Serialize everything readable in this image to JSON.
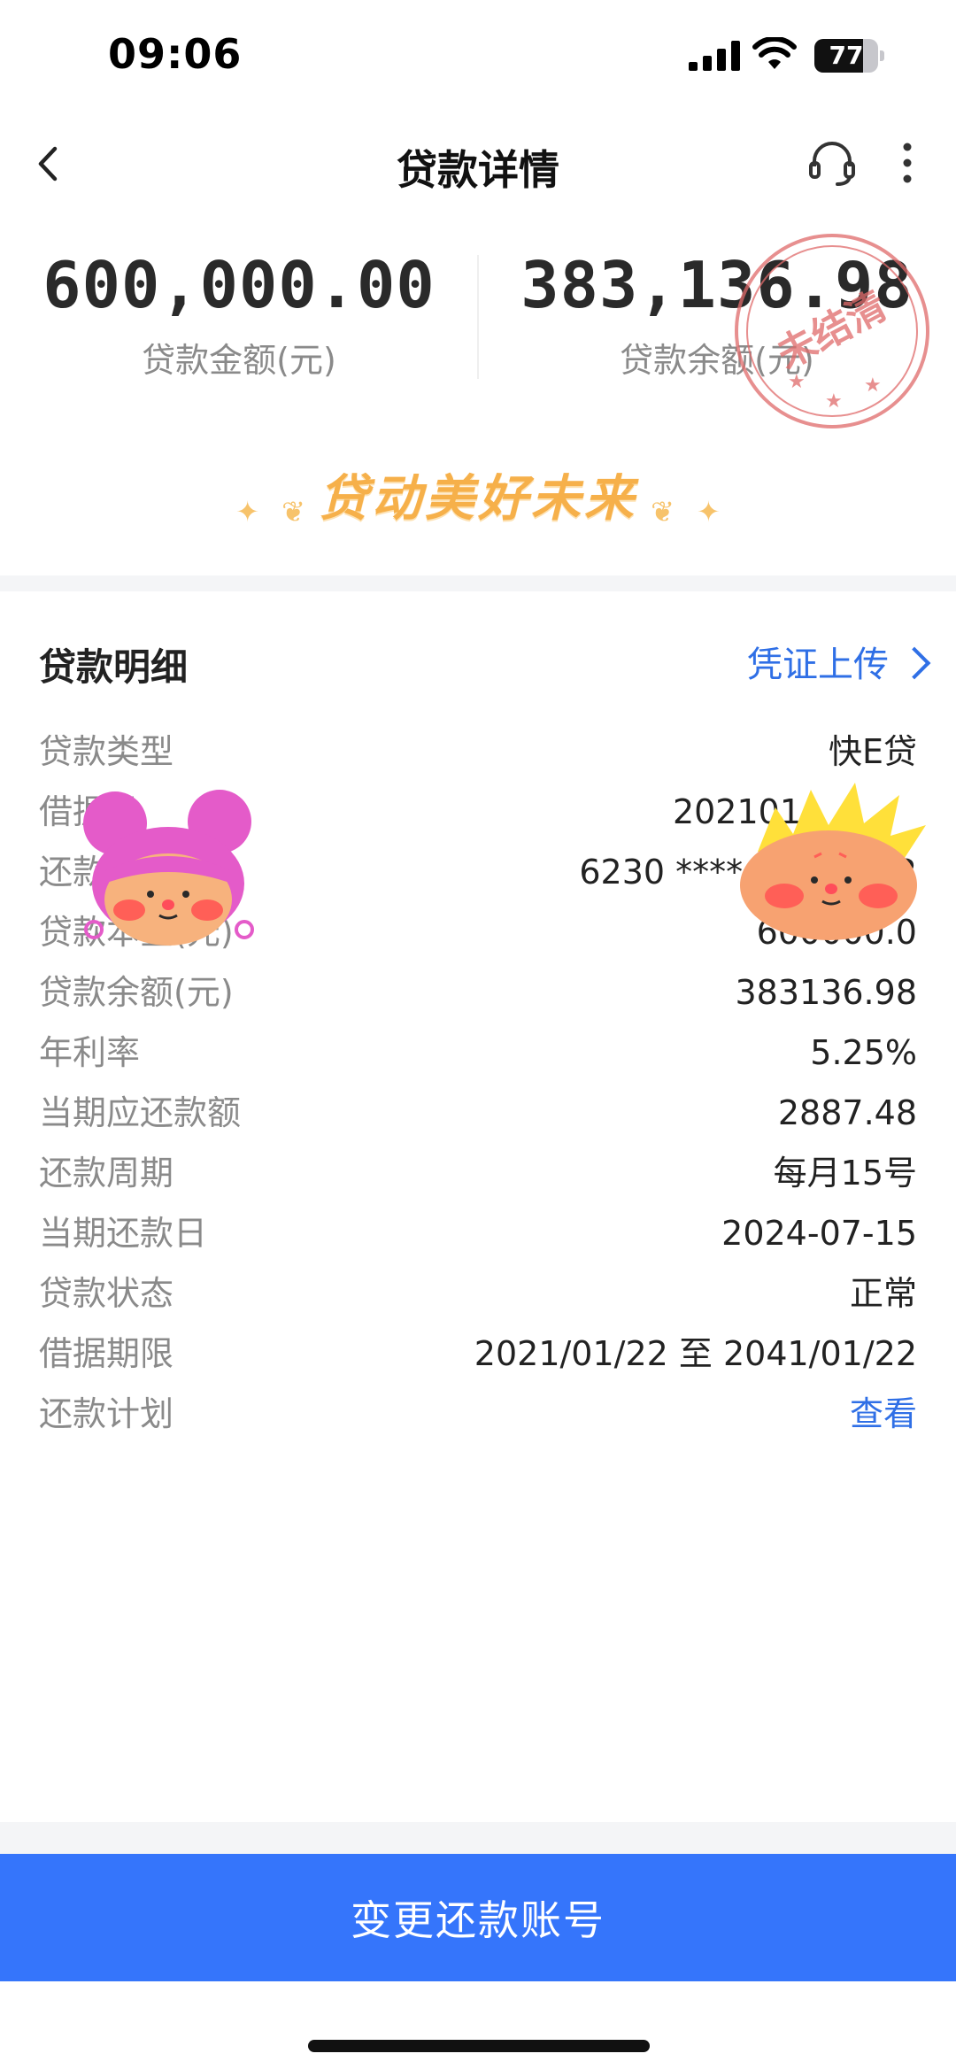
{
  "status_bar": {
    "time": "09:06",
    "battery_level": "77"
  },
  "nav": {
    "title": "贷款详情",
    "icons": [
      "back-arrow-icon",
      "headset-icon",
      "more-icon"
    ]
  },
  "summary": {
    "loan_amount": "600,000.00",
    "loan_amount_label": "贷款金额(元)",
    "balance": "383,136.98",
    "balance_label": "贷款余额(元)",
    "stamp_text": "未结清",
    "slogan": "贷动美好未来"
  },
  "details": {
    "title": "贷款明细",
    "upload_link": "凭证上传",
    "rows": [
      {
        "label": "贷款类型",
        "value": "快E贷"
      },
      {
        "label": "借据号",
        "value": "202101"
      },
      {
        "label": "还款账号",
        "value": "6230 **** **** 5512"
      },
      {
        "label": "贷款本金(元)",
        "value": "600000.0"
      },
      {
        "label": "贷款余额(元)",
        "value": "383136.98"
      },
      {
        "label": "年利率",
        "value": "5.25%"
      },
      {
        "label": "当期应还款额",
        "value": "2887.48"
      },
      {
        "label": "还款周期",
        "value": "每月15号"
      },
      {
        "label": "当期还款日",
        "value": "2024-07-15"
      },
      {
        "label": "贷款状态",
        "value": "正常"
      },
      {
        "label": "借据期限",
        "value": "2021/01/22 至 2041/01/22"
      },
      {
        "label": "还款计划",
        "value": "查看"
      }
    ]
  },
  "bottom_button": "变更还款账号",
  "colors": {
    "accent_blue": "#3575fb",
    "link_blue": "#2f6fe6",
    "slogan_gold": "#f6b04a",
    "stamp_red": "#d9534f"
  }
}
